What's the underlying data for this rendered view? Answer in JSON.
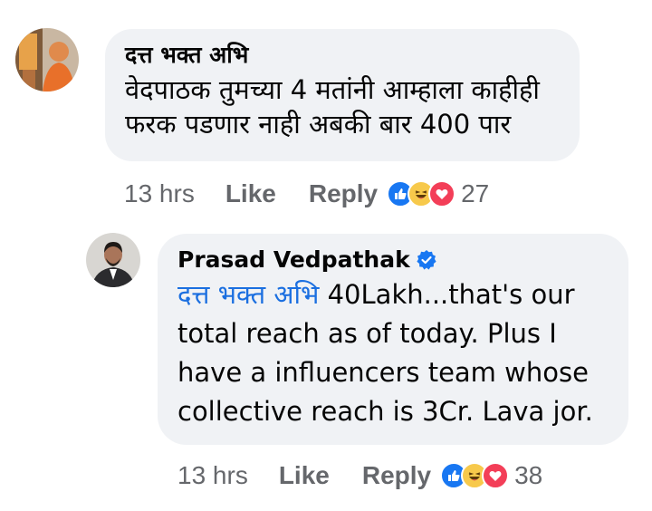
{
  "comment1": {
    "author": "दत्त भक्त अभि",
    "line1": "वेदपाठक तुमच्या 4 मतांनी आम्हाला काहीही",
    "line2": "फरक पडणार नाही अबकी बार 400 पार",
    "time": "13 hrs",
    "like_label": "Like",
    "reply_label": "Reply",
    "reaction_count": "27",
    "reactions": [
      "like-icon",
      "haha-icon",
      "love-icon"
    ]
  },
  "comment2": {
    "author": "Prasad Vedpathak",
    "verified": "verified-badge-icon",
    "mention": "दत्त भक्त अभि",
    "line1_rest": " 40Lakh...that's our",
    "line2": "total reach as of today. Plus I",
    "line3": "have a influencers team whose",
    "line4": "collective reach is 3Cr. Lava jor.",
    "time": "13 hrs",
    "like_label": "Like",
    "reply_label": "Reply",
    "reaction_count": "38",
    "reactions": [
      "like-icon",
      "haha-icon",
      "love-icon"
    ]
  },
  "colors": {
    "bubble": "#f0f2f5",
    "meta_text": "#65676b",
    "mention": "#1b6fe0",
    "like_blue": "#1877f2",
    "love_red": "#f33e58",
    "haha_yellow": "#f7c94b"
  }
}
